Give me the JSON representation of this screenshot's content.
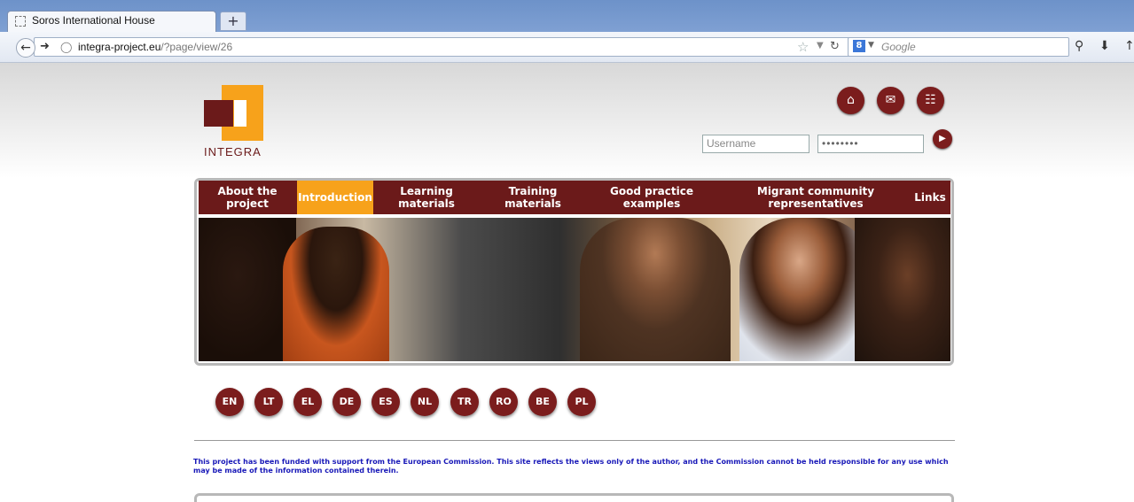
{
  "browser": {
    "tab_title": "Soros International House",
    "new_tab_symbol": "+",
    "url_host": "integra-project.eu",
    "url_path": "/?page/view/26",
    "search_placeholder": "Google",
    "search_engine_letter": "8"
  },
  "site": {
    "logo_text": "INTEGRA",
    "login": {
      "username_placeholder": "Username",
      "password_value": "••••••••"
    },
    "nav": [
      {
        "label": "About the project"
      },
      {
        "label": "Introduction",
        "active": true
      },
      {
        "label": "Learning materials"
      },
      {
        "label": "Training materials"
      },
      {
        "label": "Good practice examples"
      },
      {
        "label": "Migrant community representatives"
      },
      {
        "label": "Links"
      }
    ],
    "languages": [
      "EN",
      "LT",
      "EL",
      "DE",
      "ES",
      "NL",
      "TR",
      "RO",
      "BE",
      "PL"
    ],
    "disclaimer": "This project has been funded with support from the European Commission. This site reflects the views only of the author, and the Commission cannot be held responsible for any use which may be made of the information contained therein."
  },
  "colors": {
    "brand_maroon": "#6b1a1a",
    "brand_orange": "#f7a21b",
    "disclaimer_blue": "#1818b8"
  }
}
